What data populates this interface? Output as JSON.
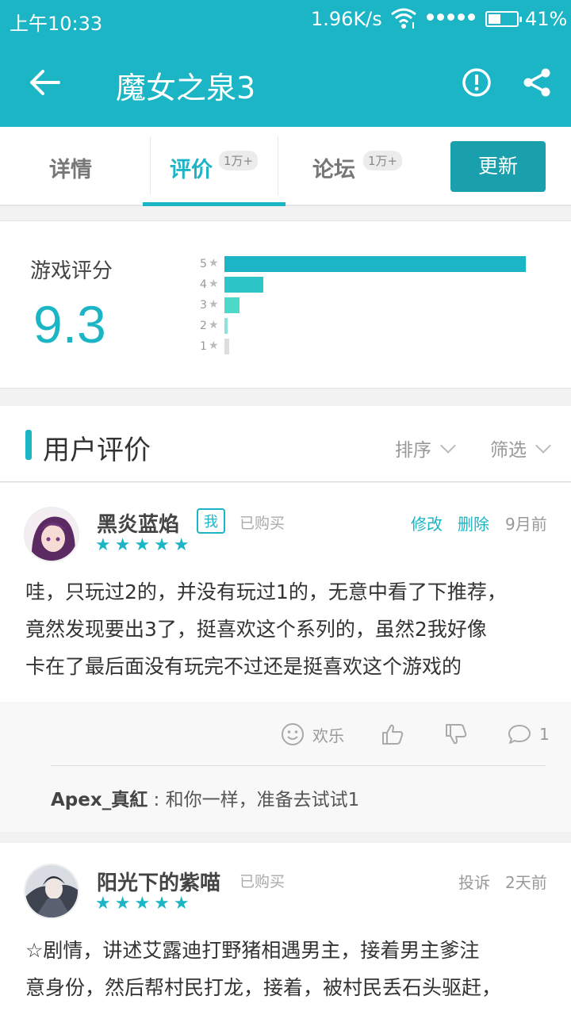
{
  "status_bar": {
    "time": "上午10:33",
    "net_speed": "1.96K/s",
    "battery_percent": "41%",
    "battery_level": 0.41,
    "icons": [
      "wifi-icon",
      "signal-icon",
      "battery-icon"
    ]
  },
  "app_bar": {
    "title": "魔女之泉3",
    "icons": [
      "back-arrow-icon",
      "report-icon",
      "share-icon"
    ]
  },
  "tabs": [
    {
      "label": "详情"
    },
    {
      "label": "评价",
      "count": "1万+",
      "active": true
    },
    {
      "label": "论坛",
      "count": "1万+"
    }
  ],
  "update_button": "更新",
  "rating": {
    "label": "游戏评分",
    "score": "9.3",
    "distribution": [
      {
        "stars": "5",
        "fraction": 1.0,
        "color": "#1cb5c5"
      },
      {
        "stars": "4",
        "fraction": 0.13,
        "color": "#2cc6c9"
      },
      {
        "stars": "3",
        "fraction": 0.05,
        "color": "#4dd9c9"
      },
      {
        "stars": "2",
        "fraction": 0.01,
        "color": "#8de3da"
      },
      {
        "stars": "1",
        "fraction": 0.015,
        "color": "#dddddd"
      }
    ]
  },
  "section": {
    "title": "用户评价",
    "sort_label": "排序",
    "filter_label": "筛选"
  },
  "reviews": [
    {
      "username": "黑炎蓝焰",
      "me_badge": "我",
      "bought": "已购买",
      "stars": "★★★★★",
      "edit": "修改",
      "delete": "删除",
      "time": "9月前",
      "lines": [
        "哇，只玩过2的，并没有玩过1的，无意中看了下推荐，",
        "竟然发现要出3了，挺喜欢这个系列的，虽然2我好像",
        "卡在了最后面没有玩完不过还是挺喜欢这个游戏的"
      ],
      "mood": "欢乐",
      "comment_count": "1",
      "reply_user": "Apex_真紅",
      "reply_text": " : 和你一样，准备去试试1"
    },
    {
      "username": "阳光下的紫喵",
      "bought": "已购买",
      "stars": "★★★★★",
      "report": "投诉",
      "time": "2天前",
      "lines": [
        "☆剧情，讲述艾露迪打野猪相遇男主，接着男主爹注",
        "意身份，然后帮村民打龙，接着，被村民丢石头驱赶，"
      ]
    }
  ]
}
